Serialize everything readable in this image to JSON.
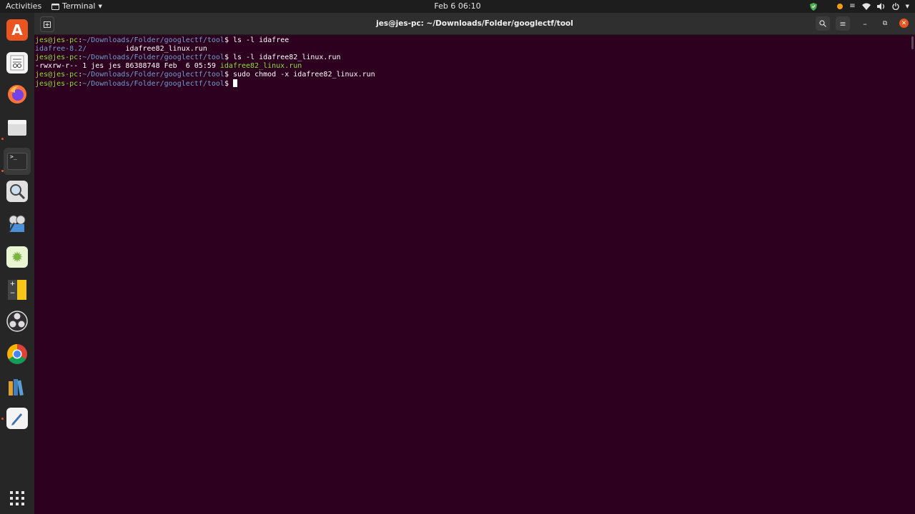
{
  "topbar": {
    "activities": "Activities",
    "app_name": "Terminal",
    "clock": "Feb 6  06:10"
  },
  "window": {
    "title": "jes@jes-pc: ~/Downloads/Folder/googlectf/tool"
  },
  "terminal": {
    "prompt_user": "jes@jes-pc",
    "prompt_path": "~/Downloads/Folder/googlectf/tool",
    "line1_cmd": " ls -l idafree",
    "line2_dir": "idafree-8.2/",
    "line2_gap": "         ",
    "line2_file": "idafree82_linux.run",
    "line3_cmd": " ls -l idafree82_linux.run",
    "line4_meta": "-rwxrw-r-- 1 jes jes 86388748 Feb  6 05:59 ",
    "line4_file": "idafree82_linux.run",
    "line5_cmd": " sudo chmod -x idafree82_linux.run",
    "line6_cmd": " "
  },
  "dock": {
    "items": [
      "ubuntu-software",
      "text-editor-notes",
      "firefox",
      "files",
      "terminal",
      "search",
      "video-editor",
      "settings",
      "calculator",
      "obs-studio",
      "chrome",
      "library",
      "text-editor"
    ]
  },
  "colors": {
    "terminal_bg": "#2c001e",
    "prompt_user": "#8ae234",
    "prompt_path": "#729fcf",
    "accent": "#e95420"
  }
}
